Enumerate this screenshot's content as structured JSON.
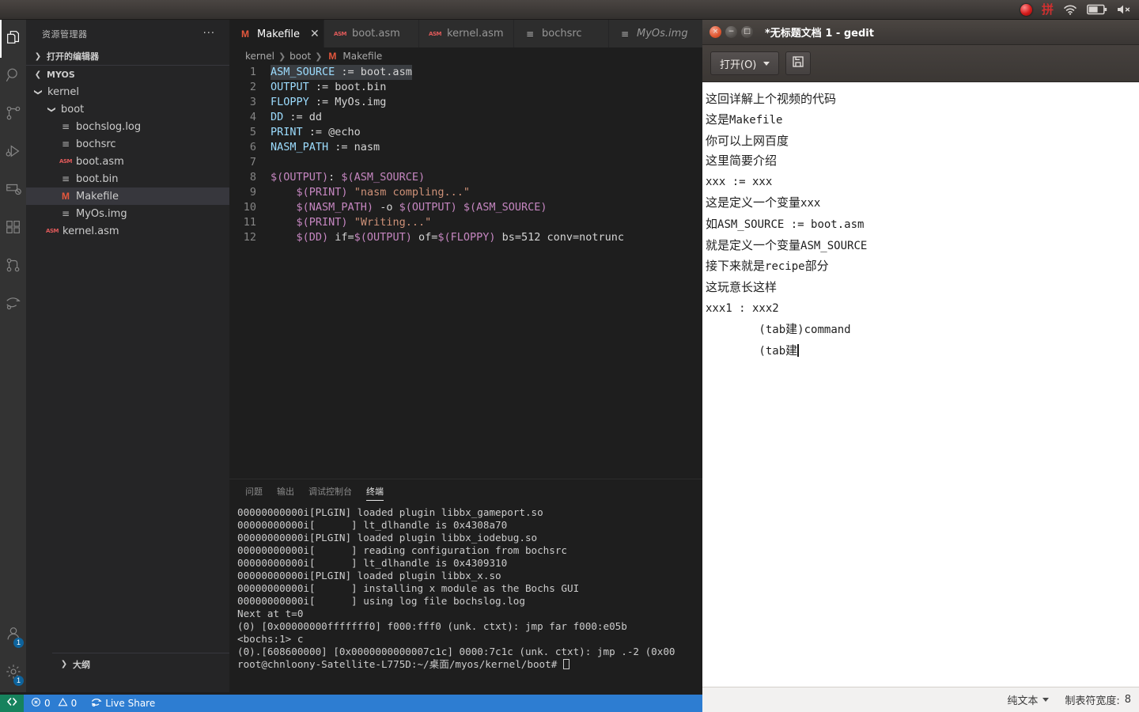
{
  "topbar": {
    "tray": [
      {
        "name": "record-indicator-icon",
        "label": "recording"
      },
      {
        "name": "ime-chinese-icon",
        "label": "拼"
      },
      {
        "name": "wifi-icon",
        "label": "wifi"
      },
      {
        "name": "battery-icon",
        "label": "battery"
      },
      {
        "name": "volume-muted-icon",
        "label": "volume muted"
      }
    ]
  },
  "vscode": {
    "activitybar": {
      "items": [
        {
          "name": "explorer",
          "icon": "files-icon",
          "active": true,
          "badge": ""
        },
        {
          "name": "search",
          "icon": "search-icon",
          "active": false,
          "badge": ""
        },
        {
          "name": "source-control",
          "icon": "source-control-icon",
          "active": false,
          "badge": ""
        },
        {
          "name": "run-and-debug",
          "icon": "run-debug-icon",
          "active": false,
          "badge": ""
        },
        {
          "name": "remote-explorer",
          "icon": "remote-icon",
          "active": false,
          "badge": ""
        },
        {
          "name": "extensions",
          "icon": "extensions-icon",
          "active": false,
          "badge": ""
        },
        {
          "name": "git-graph",
          "icon": "git-graph-icon",
          "active": false,
          "badge": ""
        },
        {
          "name": "live-share",
          "icon": "live-share-icon",
          "active": false,
          "badge": ""
        }
      ],
      "bottom": [
        {
          "name": "accounts",
          "icon": "account-icon",
          "badge": "1"
        },
        {
          "name": "manage-settings",
          "icon": "gear-icon",
          "badge": "1"
        }
      ]
    },
    "sidebar": {
      "title": "资源管理器",
      "more_actions": "···",
      "open_editors_label": "打开的编辑器",
      "workspace_label": "MYOS",
      "outline_label": "大纲",
      "tree": [
        {
          "label": "kernel",
          "indent": 1,
          "type": "folder",
          "expanded": true,
          "selected": false
        },
        {
          "label": "boot",
          "indent": 2,
          "type": "folder",
          "expanded": true,
          "selected": false
        },
        {
          "label": "bochslog.log",
          "indent": 3,
          "type": "file-lines",
          "selected": false
        },
        {
          "label": "bochsrc",
          "indent": 3,
          "type": "file-lines",
          "selected": false
        },
        {
          "label": "boot.asm",
          "indent": 3,
          "type": "file-asm",
          "selected": false
        },
        {
          "label": "boot.bin",
          "indent": 3,
          "type": "file-lines",
          "selected": false
        },
        {
          "label": "Makefile",
          "indent": 3,
          "type": "file-make",
          "selected": true
        },
        {
          "label": "MyOs.img",
          "indent": 3,
          "type": "file-lines",
          "selected": false
        },
        {
          "label": "kernel.asm",
          "indent": 2,
          "type": "file-asm",
          "selected": false
        }
      ]
    },
    "tabs": [
      {
        "label": "Makefile",
        "icon": "makefile-icon",
        "active": true,
        "preview": false,
        "closable": true
      },
      {
        "label": "boot.asm",
        "icon": "asm-icon",
        "active": false,
        "preview": false,
        "closable": false
      },
      {
        "label": "kernel.asm",
        "icon": "asm-icon",
        "active": false,
        "preview": false,
        "closable": false
      },
      {
        "label": "bochsrc",
        "icon": "lines-icon",
        "active": false,
        "preview": false,
        "closable": false
      },
      {
        "label": "MyOs.img",
        "icon": "lines-icon",
        "active": false,
        "preview": true,
        "closable": false
      }
    ],
    "breadcrumb": [
      "kernel",
      "boot",
      "Makefile"
    ],
    "editor": {
      "filename": "Makefile",
      "lines": [
        {
          "n": "1",
          "text": "ASM_SOURCE := boot.asm",
          "selected": true
        },
        {
          "n": "2",
          "text": "OUTPUT := boot.bin",
          "selected": false
        },
        {
          "n": "3",
          "text": "FLOPPY := MyOs.img",
          "selected": false
        },
        {
          "n": "4",
          "text": "DD := dd",
          "selected": false
        },
        {
          "n": "5",
          "text": "PRINT := @echo",
          "selected": false
        },
        {
          "n": "6",
          "text": "NASM_PATH := nasm",
          "selected": false
        },
        {
          "n": "7",
          "text": "",
          "selected": false
        },
        {
          "n": "8",
          "text": "$(OUTPUT): $(ASM_SOURCE)",
          "selected": false
        },
        {
          "n": "9",
          "text": "    $(PRINT) \"nasm compling...\"",
          "selected": false
        },
        {
          "n": "10",
          "text": "    $(NASM_PATH) -o $(OUTPUT) $(ASM_SOURCE)",
          "selected": false
        },
        {
          "n": "11",
          "text": "    $(PRINT) \"Writing...\"",
          "selected": false
        },
        {
          "n": "12",
          "text": "    $(DD) if=$(OUTPUT) of=$(FLOPPY) bs=512 conv=notrunc",
          "selected": false
        }
      ]
    },
    "panel": {
      "tabs": [
        {
          "label": "问题",
          "active": false
        },
        {
          "label": "输出",
          "active": false
        },
        {
          "label": "调试控制台",
          "active": false
        },
        {
          "label": "终端",
          "active": true
        }
      ],
      "terminal_lines": [
        "00000000000i[PLGIN] loaded plugin libbx_gameport.so",
        "00000000000i[      ] lt_dlhandle is 0x4308a70",
        "00000000000i[PLGIN] loaded plugin libbx_iodebug.so",
        "00000000000i[      ] reading configuration from bochsrc",
        "00000000000i[      ] lt_dlhandle is 0x4309310",
        "00000000000i[PLGIN] loaded plugin libbx_x.so",
        "00000000000i[      ] installing x module as the Bochs GUI",
        "00000000000i[      ] using log file bochslog.log",
        "Next at t=0",
        "(0) [0x00000000fffffff0] f000:fff0 (unk. ctxt): jmp far f000:e05b",
        "<bochs:1> c",
        "(0).[608600000] [0x0000000000007c1c] 0000:7c1c (unk. ctxt): jmp .-2 (0x00",
        "root@chnloony-Satellite-L775D:~/桌面/myos/kernel/boot# "
      ]
    },
    "statusbar": {
      "remote_icon": "remote-indicator-icon",
      "errors": "0",
      "warnings": "0",
      "live_share": "Live Share"
    }
  },
  "gedit": {
    "title": "*无标题文档 1 - gedit",
    "window_buttons": [
      {
        "name": "close-button",
        "glyph": "×"
      },
      {
        "name": "minimize-button",
        "glyph": "−"
      },
      {
        "name": "maximize-button",
        "glyph": "□"
      }
    ],
    "toolbar": {
      "open_label": "打开(O)",
      "save_icon": "save-icon"
    },
    "document_lines": [
      "这回详解上个视频的代码",
      "这是Makefile",
      "你可以上网百度",
      "这里简要介绍",
      "xxx := xxx",
      "这是定义一个变量xxx",
      "如ASM_SOURCE := boot.asm",
      "就是定义一个变量ASM_SOURCE",
      "接下来就是recipe部分",
      "这玩意长这样",
      "xxx1 : xxx2",
      "        (tab建)command",
      "        (tab建"
    ],
    "statusbar": {
      "language": "纯文本",
      "tab_width_label": "制表符宽度:",
      "tab_width_value": "8"
    }
  }
}
